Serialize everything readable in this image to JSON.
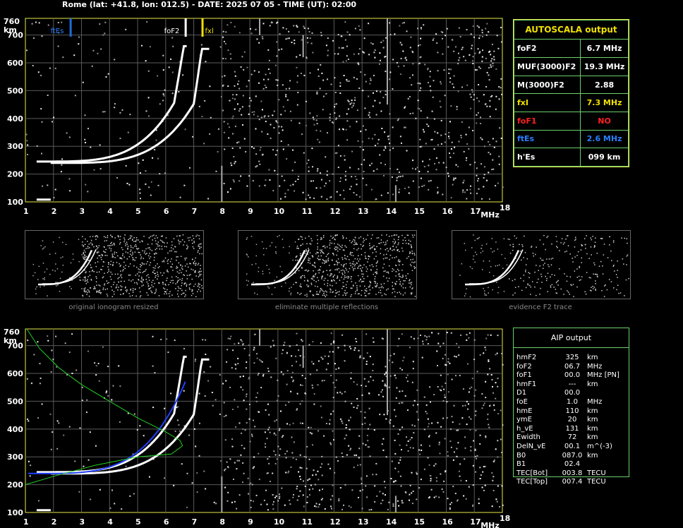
{
  "header": "Rome (lat: +41.8, lon: 012.5) - DATE: 2025 07 05 - TIME (UT): 02:00",
  "top_chart": {
    "y_axis_top": "760",
    "y_unit": "km",
    "y_ticks": [
      "700",
      "600",
      "500",
      "400",
      "300",
      "200",
      "100"
    ],
    "x_ticks": [
      "1",
      "2",
      "3",
      "4",
      "5",
      "6",
      "7",
      "8",
      "9",
      "10",
      "11",
      "12",
      "13",
      "14",
      "15",
      "16",
      "17",
      "18"
    ],
    "x_unit": "MHz",
    "markers": [
      {
        "label": "ftEs",
        "freq": 2.6,
        "color": "#1e6bd8"
      },
      {
        "label": "foF2",
        "freq": 6.7,
        "color": "#ffffff"
      },
      {
        "label": "fxl",
        "freq": 7.3,
        "color": "#f0e000"
      }
    ]
  },
  "autoscala": {
    "title": "AUTOSCALA output",
    "rows": [
      {
        "name": "foF2",
        "value": "6.7 MHz",
        "color": "#ffffff"
      },
      {
        "name": "MUF(3000)F2",
        "value": "19.3 MHz",
        "color": "#ffffff"
      },
      {
        "name": "M(3000)F2",
        "value": "2.88",
        "color": "#ffffff"
      },
      {
        "name": "fxI",
        "value": "7.3 MHz",
        "color": "#f0e000"
      },
      {
        "name": "foF1",
        "value": "NO",
        "color": "#ff2020"
      },
      {
        "name": "ftEs",
        "value": "2.6 MHz",
        "color": "#2a7fff"
      },
      {
        "name": "h'Es",
        "value": "099     km",
        "color": "#ffffff"
      }
    ]
  },
  "thumbnails": [
    {
      "caption": "original ionogram resized"
    },
    {
      "caption": "eliminate multiple reflections"
    },
    {
      "caption": "evidence F2 trace"
    }
  ],
  "bottom_chart": {
    "y_axis_top": "760",
    "y_unit": "km",
    "y_ticks": [
      "700",
      "600",
      "500",
      "400",
      "300",
      "200",
      "100"
    ],
    "x_ticks": [
      "1",
      "2",
      "3",
      "4",
      "5",
      "6",
      "7",
      "8",
      "9",
      "10",
      "11",
      "12",
      "13",
      "14",
      "15",
      "16",
      "17",
      "18"
    ],
    "x_unit": "MHz"
  },
  "aip": {
    "title": "AIP output",
    "rows": [
      {
        "name": "hmF2",
        "value": "325",
        "unit": "km"
      },
      {
        "name": "foF2",
        "value": "06.7",
        "unit": "MHz"
      },
      {
        "name": "foF1",
        "value": "00.0",
        "unit": "MHz    [PN]"
      },
      {
        "name": "hmF1",
        "value": "---",
        "unit": "km"
      },
      {
        "name": "D1",
        "value": "00.0",
        "unit": ""
      },
      {
        "name": "foE",
        "value": "1.0",
        "unit": "MHz"
      },
      {
        "name": "hmE",
        "value": "110",
        "unit": "km"
      },
      {
        "name": "ymE",
        "value": "20",
        "unit": "km"
      },
      {
        "name": "h_vE",
        "value": "131",
        "unit": "km"
      },
      {
        "name": "Ewidth",
        "value": "72",
        "unit": "km"
      },
      {
        "name": "DelN_vE",
        "value": "00.1",
        "unit": "m^(-3)"
      },
      {
        "name": "B0",
        "value": "087.0",
        "unit": "km"
      },
      {
        "name": "B1",
        "value": "02.4",
        "unit": ""
      },
      {
        "name": "TEC[Bot]",
        "value": "003.8",
        "unit": "TECU"
      },
      {
        "name": "TEC[Top]",
        "value": "007.4",
        "unit": "TECU"
      }
    ]
  }
}
